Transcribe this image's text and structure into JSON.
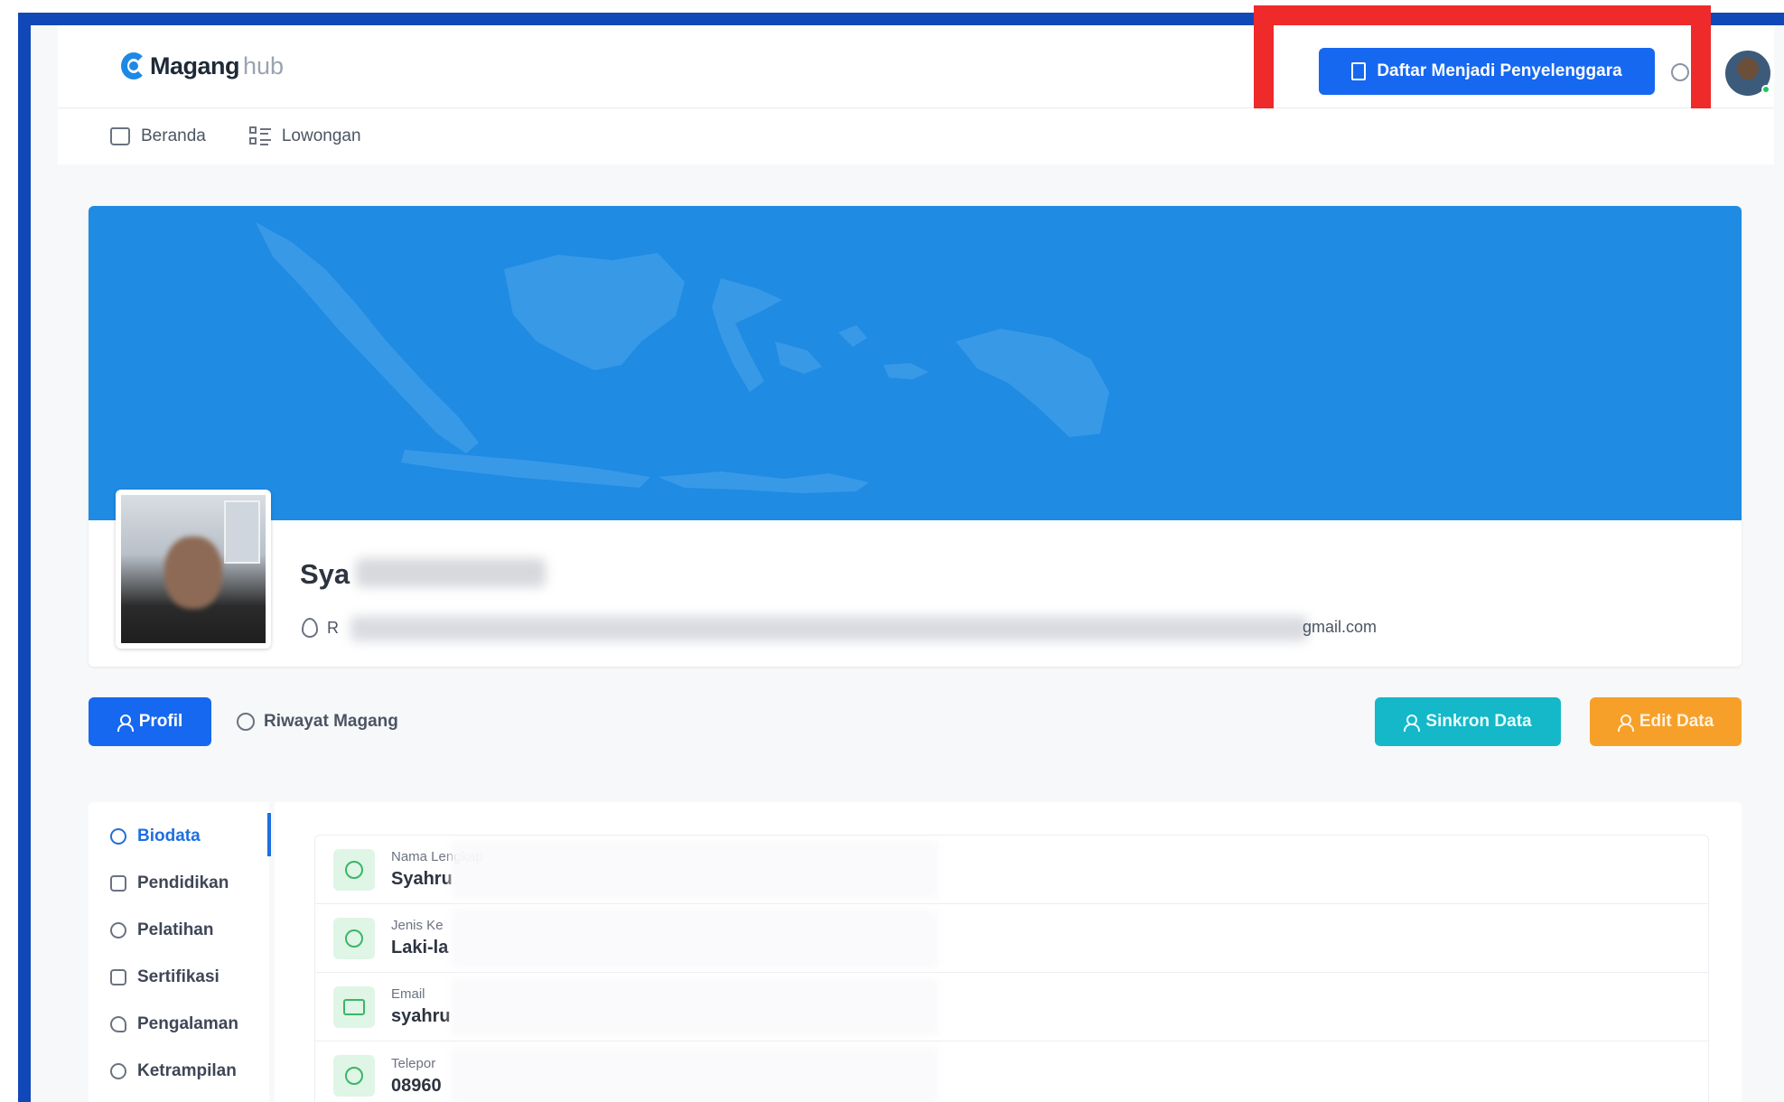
{
  "header": {
    "logo_brand": "Magang",
    "logo_suffix": "hub",
    "cta_label": "Daftar Menjadi Penyelenggara"
  },
  "nav": {
    "items": [
      {
        "label": "Beranda",
        "icon": "home-icon"
      },
      {
        "label": "Lowongan",
        "icon": "list-icon"
      }
    ]
  },
  "profile": {
    "name_visible": "Sya",
    "address_visible": "R",
    "email_visible": "gmail.com",
    "banner_color": "#1f8be3"
  },
  "tabs": {
    "profil": "Profil",
    "riwayat": "Riwayat Magang",
    "sinkron": "Sinkron Data",
    "edit": "Edit Data"
  },
  "sidebar": {
    "items": [
      {
        "label": "Biodata",
        "icon": "user-icon",
        "active": true
      },
      {
        "label": "Pendidikan",
        "icon": "monitor-icon"
      },
      {
        "label": "Pelatihan",
        "icon": "user-award-icon"
      },
      {
        "label": "Sertifikasi",
        "icon": "certificate-icon"
      },
      {
        "label": "Pengalaman",
        "icon": "heart-icon"
      },
      {
        "label": "Ketrampilan",
        "icon": "user-skill-icon"
      }
    ]
  },
  "biodata": {
    "rows": [
      {
        "label": "Nama Lengkap",
        "value": "Syahru"
      },
      {
        "label": "Jenis Ke",
        "value": "Laki-la"
      },
      {
        "label": "Email",
        "value": "syahru"
      },
      {
        "label": "Telepor",
        "value": "08960"
      }
    ]
  },
  "colors": {
    "primary": "#1668f0",
    "sinkron": "#14b8c8",
    "edit": "#f6a02a",
    "highlight": "#ee2a2a",
    "frame": "#1148b7"
  }
}
